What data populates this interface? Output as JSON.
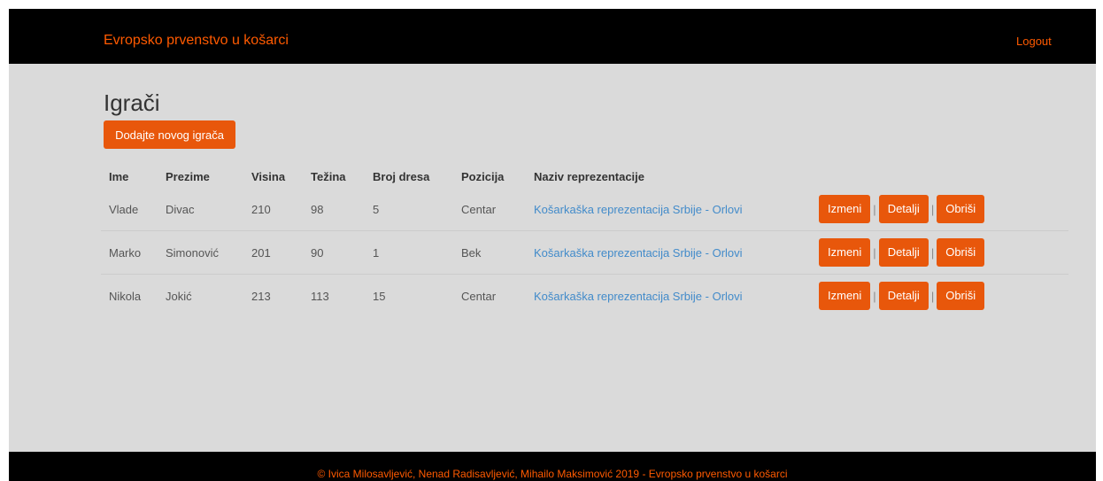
{
  "colors": {
    "brand": "#ff5a00",
    "button_bg": "#e8570b",
    "link": "#428bca",
    "page_bg": "#dadada",
    "navbar_bg": "#000000"
  },
  "navbar": {
    "brand": "Evropsko prvenstvo u košarci",
    "logout": "Logout"
  },
  "main": {
    "title": "Igrači",
    "add_button": "Dodajte novog igrača",
    "table": {
      "headers": [
        "Ime",
        "Prezime",
        "Visina",
        "Težina",
        "Broj dresa",
        "Pozicija",
        "Naziv reprezentacije"
      ],
      "rows": [
        [
          "Vlade",
          "Divac",
          "210",
          "98",
          "5",
          "Centar",
          "Košarkaška reprezentacija Srbije - Orlovi"
        ],
        [
          "Marko",
          "Simonović",
          "201",
          "90",
          "1",
          "Bek",
          "Košarkaška reprezentacija Srbije - Orlovi"
        ],
        [
          "Nikola",
          "Jokić",
          "213",
          "113",
          "15",
          "Centar",
          "Košarkaška reprezentacija Srbije - Orlovi"
        ]
      ],
      "actions": {
        "edit": "Izmeni",
        "details": "Detalji",
        "delete": "Obriši",
        "separator": "|"
      }
    }
  },
  "footer": {
    "text": "© Ivica Milosavljević, Nenad Radisavljević, Mihailo Maksimović 2019 - Evropsko prvenstvo u košarci"
  }
}
